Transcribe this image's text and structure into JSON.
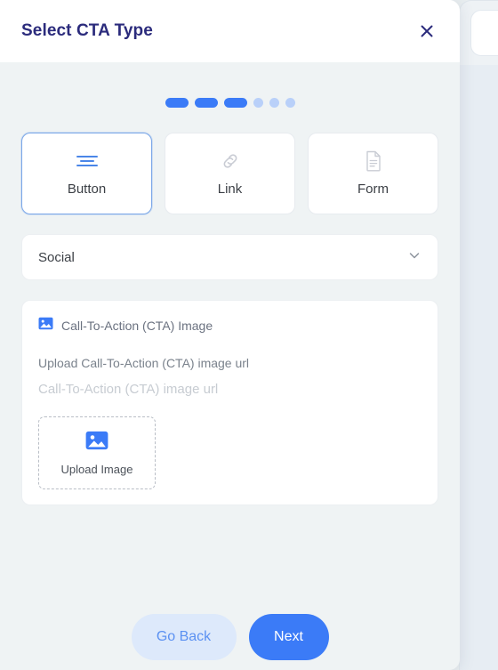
{
  "modal": {
    "title": "Select CTA Type",
    "close_icon": "close-icon"
  },
  "stepper": {
    "total": 6,
    "active": 3,
    "active_color": "#3b7bf7",
    "inactive_color": "#b9d0f9"
  },
  "type_cards": [
    {
      "label": "Button",
      "icon": "menu-lines-icon",
      "selected": true
    },
    {
      "label": "Link",
      "icon": "link-chain-icon",
      "selected": false
    },
    {
      "label": "Form",
      "icon": "document-icon",
      "selected": false
    }
  ],
  "category_select": {
    "value": "Social",
    "chevron_icon": "chevron-down-icon"
  },
  "image_section": {
    "icon": "image-icon",
    "heading": "Call-To-Action (CTA) Image",
    "upload_label": "Upload Call-To-Action (CTA) image url",
    "url_placeholder": "Call-To-Action (CTA) image url",
    "dropzone": {
      "icon": "image-icon",
      "label": "Upload Image"
    }
  },
  "footer": {
    "back_label": "Go Back",
    "next_label": "Next"
  },
  "colors": {
    "accent": "#3b7bf7",
    "title": "#2b2b7c",
    "body_bg": "#eff3f4",
    "card_bg": "#ffffff"
  }
}
